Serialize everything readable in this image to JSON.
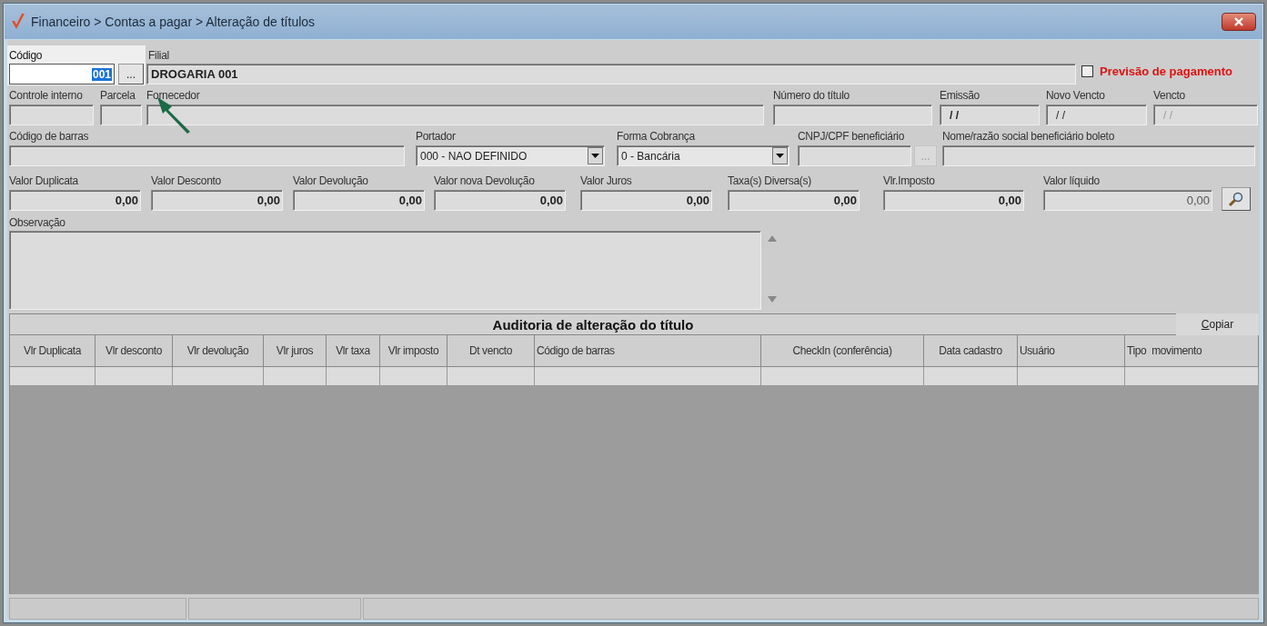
{
  "window": {
    "title": "Financeiro > Contas a pagar > Alteração de títulos"
  },
  "codigo": {
    "label": "Código",
    "value": "001",
    "value_selected": true,
    "button": "..."
  },
  "filial": {
    "label": "Filial",
    "value": "DROGARIA 001"
  },
  "previsao": {
    "label": "Previsão de pagamento",
    "checked": false
  },
  "row2": [
    {
      "label": "Controle interno",
      "kind": "text"
    },
    {
      "label": "Parcela",
      "kind": "text"
    },
    {
      "label": "Fornecedor",
      "kind": "text"
    },
    {
      "label": "Número do título",
      "kind": "text"
    },
    {
      "label": "Emissão",
      "kind": "date",
      "value": "/ /",
      "disabled": false
    },
    {
      "label": "Novo Vencto",
      "kind": "date",
      "value": "/ /",
      "disabled": false
    },
    {
      "label": "Vencto",
      "kind": "date",
      "value": "/ /",
      "disabled": true
    }
  ],
  "row3": [
    {
      "label": "Código de barras",
      "kind": "text"
    },
    {
      "label": "Portador",
      "kind": "select",
      "value": "000 - NAO DEFINIDO"
    },
    {
      "label": "Forma Cobrança",
      "kind": "select",
      "value": "0 - Bancária"
    },
    {
      "label": "CNPJ/CPF beneficiário",
      "kind": "lookup",
      "lookup": {
        "button": "...",
        "disabled": true
      }
    },
    {
      "label": "Nome/razão social beneficiário boleto",
      "kind": "text"
    }
  ],
  "values": [
    {
      "label": "Valor Duplicata",
      "value": "0,00",
      "kind": "bold"
    },
    {
      "label": "Valor Desconto",
      "value": "0,00",
      "kind": "bold"
    },
    {
      "label": "Valor Devolução",
      "value": "0,00",
      "kind": "bold"
    },
    {
      "label": "Valor nova Devolução",
      "value": "0,00",
      "kind": "bold"
    },
    {
      "label": "Valor Juros",
      "value": "0,00",
      "kind": "bold"
    },
    {
      "label": "Taxa(s) Diversa(s)",
      "value": "0,00",
      "kind": "bold"
    },
    {
      "label": "Vlr.Imposto",
      "value": "0,00",
      "kind": "bold"
    },
    {
      "label": "Valor líquido",
      "value": "0,00",
      "kind": "normal"
    }
  ],
  "observacao": {
    "label": "Observação"
  },
  "audit": {
    "title": "Auditoria de alteração do título",
    "copy_button": "Copiar",
    "columns": [
      {
        "label": "Vlr Duplicata"
      },
      {
        "label": "Vlr desconto"
      },
      {
        "label": "Vlr devolução"
      },
      {
        "label": "Vlr juros"
      },
      {
        "label": "Vlr taxa"
      },
      {
        "label": "Vlr imposto"
      },
      {
        "label": "Dt vencto"
      },
      {
        "label": "Código de barras"
      },
      {
        "label": "CheckIn (conferência)"
      },
      {
        "label": "Data cadastro"
      },
      {
        "label": "Usuário"
      },
      {
        "label": "Tipo  movimento"
      }
    ]
  }
}
